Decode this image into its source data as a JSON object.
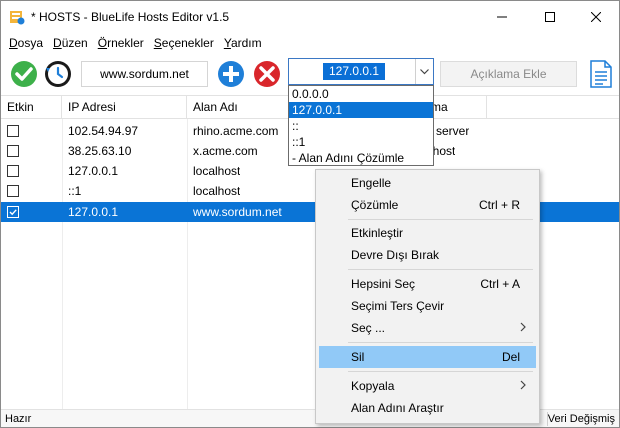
{
  "window": {
    "title": "* HOSTS - BlueLife Hosts Editor v1.5"
  },
  "menubar": [
    {
      "label": "Dosya",
      "accel": "D"
    },
    {
      "label": "Düzen",
      "accel": "D"
    },
    {
      "label": "Örnekler",
      "accel": "Ö"
    },
    {
      "label": "Seçenekler",
      "accel": "S"
    },
    {
      "label": "Yardım",
      "accel": "Y"
    }
  ],
  "toolbar": {
    "domain_value": "www.sordum.net",
    "ip_value": "127.0.0.1",
    "description_placeholder": "Açıklama Ekle"
  },
  "table": {
    "columns": [
      "Etkin",
      "IP Adresi",
      "Alan Adı",
      "ma"
    ],
    "rows": [
      {
        "enabled": false,
        "ip": "102.54.94.97",
        "domain": "rhino.acme.com",
        "note": "e server"
      },
      {
        "enabled": false,
        "ip": "38.25.63.10",
        "domain": "x.acme.com",
        "note": "t host"
      },
      {
        "enabled": false,
        "ip": "127.0.0.1",
        "domain": "localhost",
        "note": ""
      },
      {
        "enabled": false,
        "ip": "::1",
        "domain": "localhost",
        "note": ""
      },
      {
        "enabled": true,
        "ip": "127.0.0.1",
        "domain": "www.sordum.net",
        "note": "",
        "selected": true
      }
    ]
  },
  "dropdown": {
    "options": [
      "0.0.0.0",
      "127.0.0.1",
      "::",
      "::1",
      "- Alan Adını Çözümle"
    ],
    "selected_index": 1
  },
  "context_menu": {
    "items": [
      {
        "label": "Engelle",
        "shortcut": ""
      },
      {
        "label": "Çözümle",
        "shortcut": "Ctrl + R"
      },
      {
        "label": "Etkinleştir",
        "shortcut": ""
      },
      {
        "label": "Devre Dışı Bırak",
        "shortcut": ""
      },
      {
        "label": "Hepsini Seç",
        "shortcut": "Ctrl + A"
      },
      {
        "label": "Seçimi Ters Çevir",
        "shortcut": ""
      },
      {
        "label": "Seç ...",
        "shortcut": ""
      },
      {
        "label": "Sil",
        "shortcut": "Del"
      },
      {
        "label": "Kopyala",
        "shortcut": ""
      },
      {
        "label": "Alan Adını Araştır",
        "shortcut": ""
      }
    ]
  },
  "status": {
    "left": "Hazır",
    "right": "Veri Değişmiş"
  },
  "colors": {
    "selection": "#0a74d6",
    "menu_hover": "#91c9f7",
    "confirm_green": "#3db04a",
    "delete_red": "#d9262b",
    "add_blue": "#1f7fd8"
  }
}
